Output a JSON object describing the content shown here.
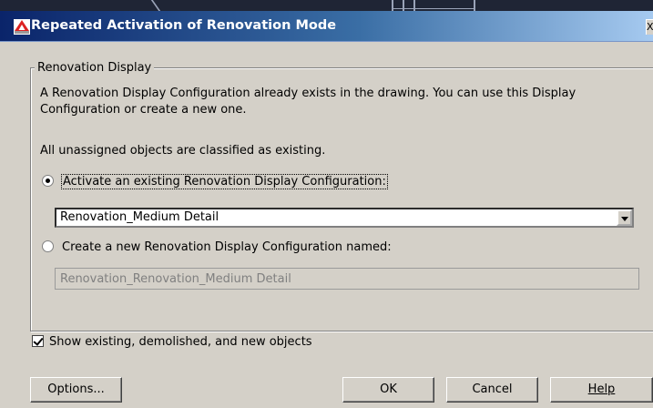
{
  "window": {
    "title": "Repeated Activation of Renovation Mode",
    "close_glyph": "X"
  },
  "group": {
    "legend": "Renovation Display",
    "description": "A Renovation Display Configuration already exists in the drawing. You can use this Display Configuration or create a new one.",
    "unassigned_note": "All unassigned objects are classified as existing."
  },
  "option_existing": {
    "label": "Activate an existing Renovation Display Configuration:",
    "selected": true,
    "dropdown_value": "Renovation_Medium Detail"
  },
  "option_new": {
    "label": "Create a new Renovation Display Configuration named:",
    "selected": false,
    "name_value": "Renovation_Renovation_Medium Detail"
  },
  "show_objects": {
    "label": "Show existing, demolished, and new objects",
    "checked": true
  },
  "buttons": {
    "options": "Options...",
    "ok": "OK",
    "cancel": "Cancel",
    "help": "Help"
  },
  "colors": {
    "title_gradient_start": "#0a246a",
    "title_gradient_end": "#a6caf0",
    "dialog_face": "#d4d0c8"
  }
}
